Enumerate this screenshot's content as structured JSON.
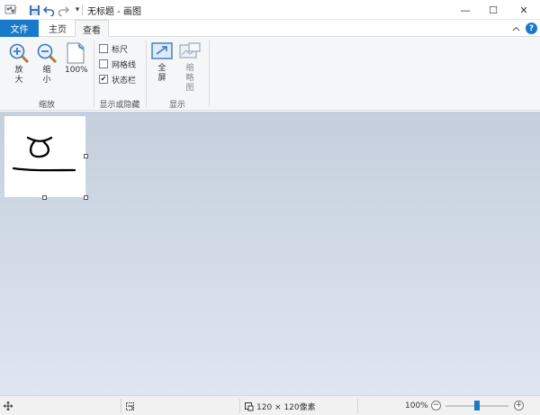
{
  "window": {
    "title": "无标题 - 画图",
    "minimize_glyph": "—",
    "maximize_glyph": "☐",
    "close_glyph": "✕"
  },
  "quick_access": {
    "dropdown_glyph": "▾"
  },
  "tabs": {
    "file": "文件",
    "home": "主页",
    "view": "查看",
    "help_glyph": "?"
  },
  "ribbon": {
    "zoom_group": {
      "label": "缩放",
      "zoom_in": "放大",
      "zoom_out": "缩小",
      "hundred": "100%"
    },
    "show_hide_group": {
      "label": "显示或隐藏",
      "ruler": {
        "label": "标尺",
        "checked": false
      },
      "gridlines": {
        "label": "网格线",
        "checked": false
      },
      "statusbar": {
        "label": "状态栏",
        "checked": true,
        "mark": "✔"
      }
    },
    "display_group": {
      "label": "显示",
      "fullscreen": "全屏",
      "thumbnail": "缩略图"
    }
  },
  "status": {
    "canvas_size": "120 × 120像素",
    "zoom_level": "100%",
    "zoom_minus": "−",
    "zoom_plus": "+"
  },
  "colors": {
    "accent": "#1979ca",
    "ribbon_bg": "#f5f6f7",
    "workspace_top": "#c5cfdd",
    "workspace_bottom": "#dfe6f1"
  }
}
